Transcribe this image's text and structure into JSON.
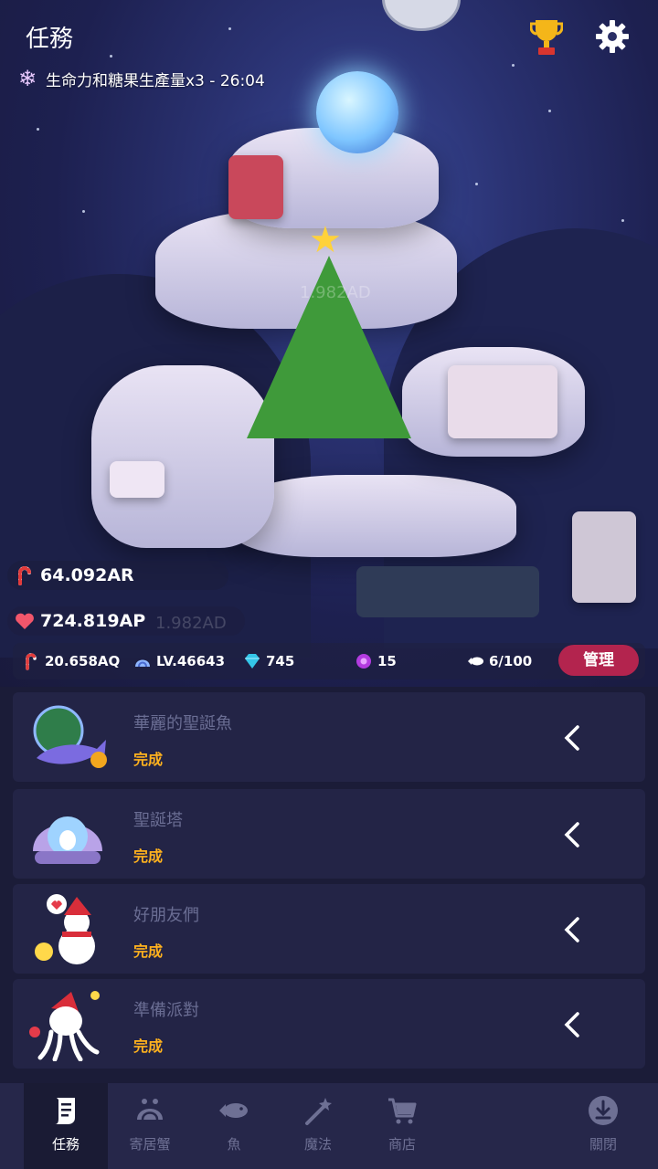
{
  "header": {
    "title": "任務",
    "boost_text": "生命力和糖果生產量x3 - 26:04"
  },
  "scene": {
    "ghost_label_1": "1.982AD",
    "ghost_label_2": "1.982AD"
  },
  "resources": {
    "candy_value": "64.092AR",
    "heart_value": "724.819AP"
  },
  "stats": {
    "tap_value": "20.658AQ",
    "level": "LV.46643",
    "gems": "745",
    "orbs": "15",
    "fish": "6/100",
    "manage_label": "管理"
  },
  "tasks": [
    {
      "name": "華麗的聖誕魚",
      "status": "完成"
    },
    {
      "name": "聖誕塔",
      "status": "完成"
    },
    {
      "name": "好朋友們",
      "status": "完成"
    },
    {
      "name": "準備派對",
      "status": "完成"
    }
  ],
  "nav": [
    {
      "label": "任務",
      "icon": "scroll-icon",
      "active": true
    },
    {
      "label": "寄居蟹",
      "icon": "hermit-crab-icon",
      "active": false
    },
    {
      "label": "魚",
      "icon": "fish-icon",
      "active": false
    },
    {
      "label": "魔法",
      "icon": "magic-wand-icon",
      "active": false
    },
    {
      "label": "商店",
      "icon": "cart-icon",
      "active": false
    },
    {
      "label": "關閉",
      "icon": "download-icon",
      "active": false
    }
  ],
  "colors": {
    "accent": "#b3244e",
    "status": "#ffb21e",
    "panel": "#232446"
  }
}
